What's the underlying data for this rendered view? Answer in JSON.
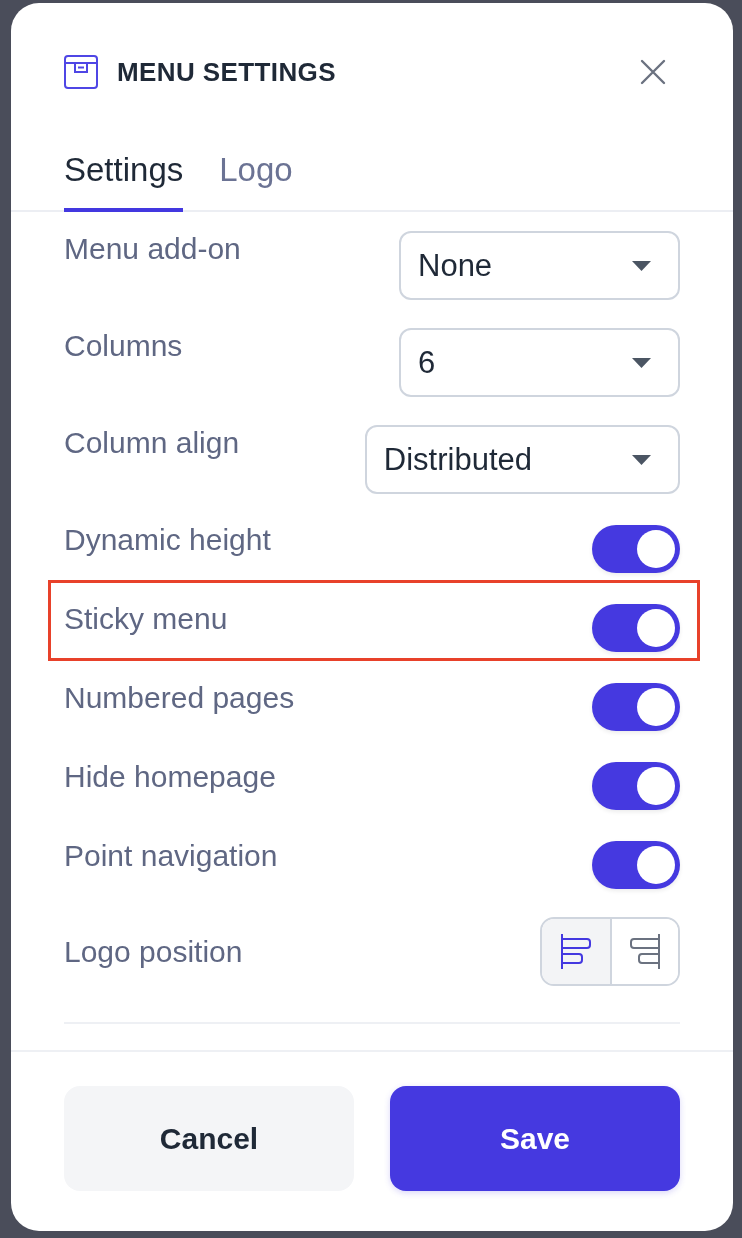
{
  "dialog": {
    "title": "MENU SETTINGS",
    "tabs": [
      {
        "label": "Settings",
        "selected": true
      },
      {
        "label": "Logo",
        "selected": false
      }
    ],
    "settings": [
      {
        "kind": "select",
        "label": "Menu add-on",
        "value": "None",
        "highlighted": false
      },
      {
        "kind": "select",
        "label": "Columns",
        "value": "6",
        "highlighted": false
      },
      {
        "kind": "select",
        "label": "Column align",
        "value": "Distributed",
        "highlighted": false
      },
      {
        "kind": "toggle",
        "label": "Dynamic height",
        "on": true,
        "highlighted": false
      },
      {
        "kind": "toggle",
        "label": "Sticky menu",
        "on": true,
        "highlighted": true
      },
      {
        "kind": "toggle",
        "label": "Numbered pages",
        "on": true,
        "highlighted": false
      },
      {
        "kind": "toggle",
        "label": "Hide homepage",
        "on": true,
        "highlighted": false
      },
      {
        "kind": "toggle",
        "label": "Point navigation",
        "on": true,
        "highlighted": false
      },
      {
        "kind": "segmented",
        "label": "Logo position",
        "highlighted": false,
        "options": [
          {
            "kind": "left",
            "selected": true
          },
          {
            "kind": "right",
            "selected": false
          }
        ]
      }
    ],
    "buttons": [
      {
        "label": "Cancel",
        "kind": "secondary"
      },
      {
        "label": "Save",
        "kind": "primary"
      }
    ]
  }
}
